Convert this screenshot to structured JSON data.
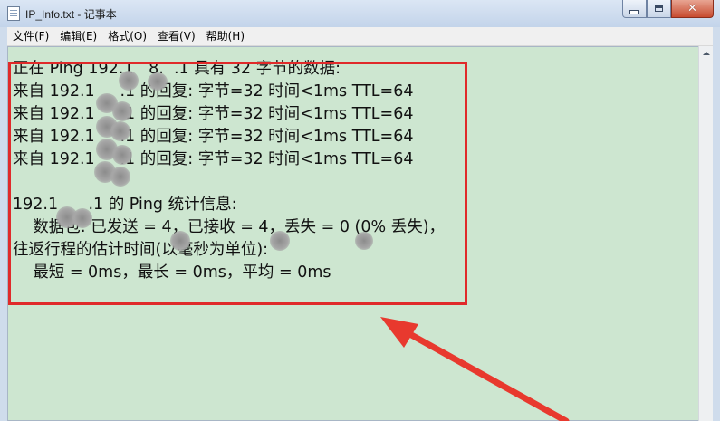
{
  "window": {
    "title": "IP_Info.txt - 记事本",
    "close_glyph": "✕"
  },
  "menu": [
    "文件(F)",
    "编辑(E)",
    "格式(O)",
    "查看(V)",
    "帮助(H)"
  ],
  "document": {
    "lines": [
      "正在 Ping 192.1   8.  .1 具有 32 字节的数据:",
      "来自 192.1     .1 的回复: 字节=32 时间<1ms TTL=64",
      "来自 192.1     .1 的回复: 字节=32 时间<1ms TTL=64",
      "来自 192.1     .1 的回复: 字节=32 时间<1ms TTL=64",
      "来自 192.1     .1 的回复: 字节=32 时间<1ms TTL=64",
      "",
      "192.1      .1 的 Ping 统计信息:",
      "    数据包: 已发送 = 4，已接收 = 4，丢失 = 0 (0% 丢失)，",
      "往返行程的估计时间(以毫秒为单位):",
      "    最短 = 0ms，最长 = 0ms，平均 = 0ms"
    ]
  },
  "colors": {
    "editor_bg": "#cde6d0",
    "highlight_box": "#e02a2a",
    "arrow": "#e8392e"
  }
}
